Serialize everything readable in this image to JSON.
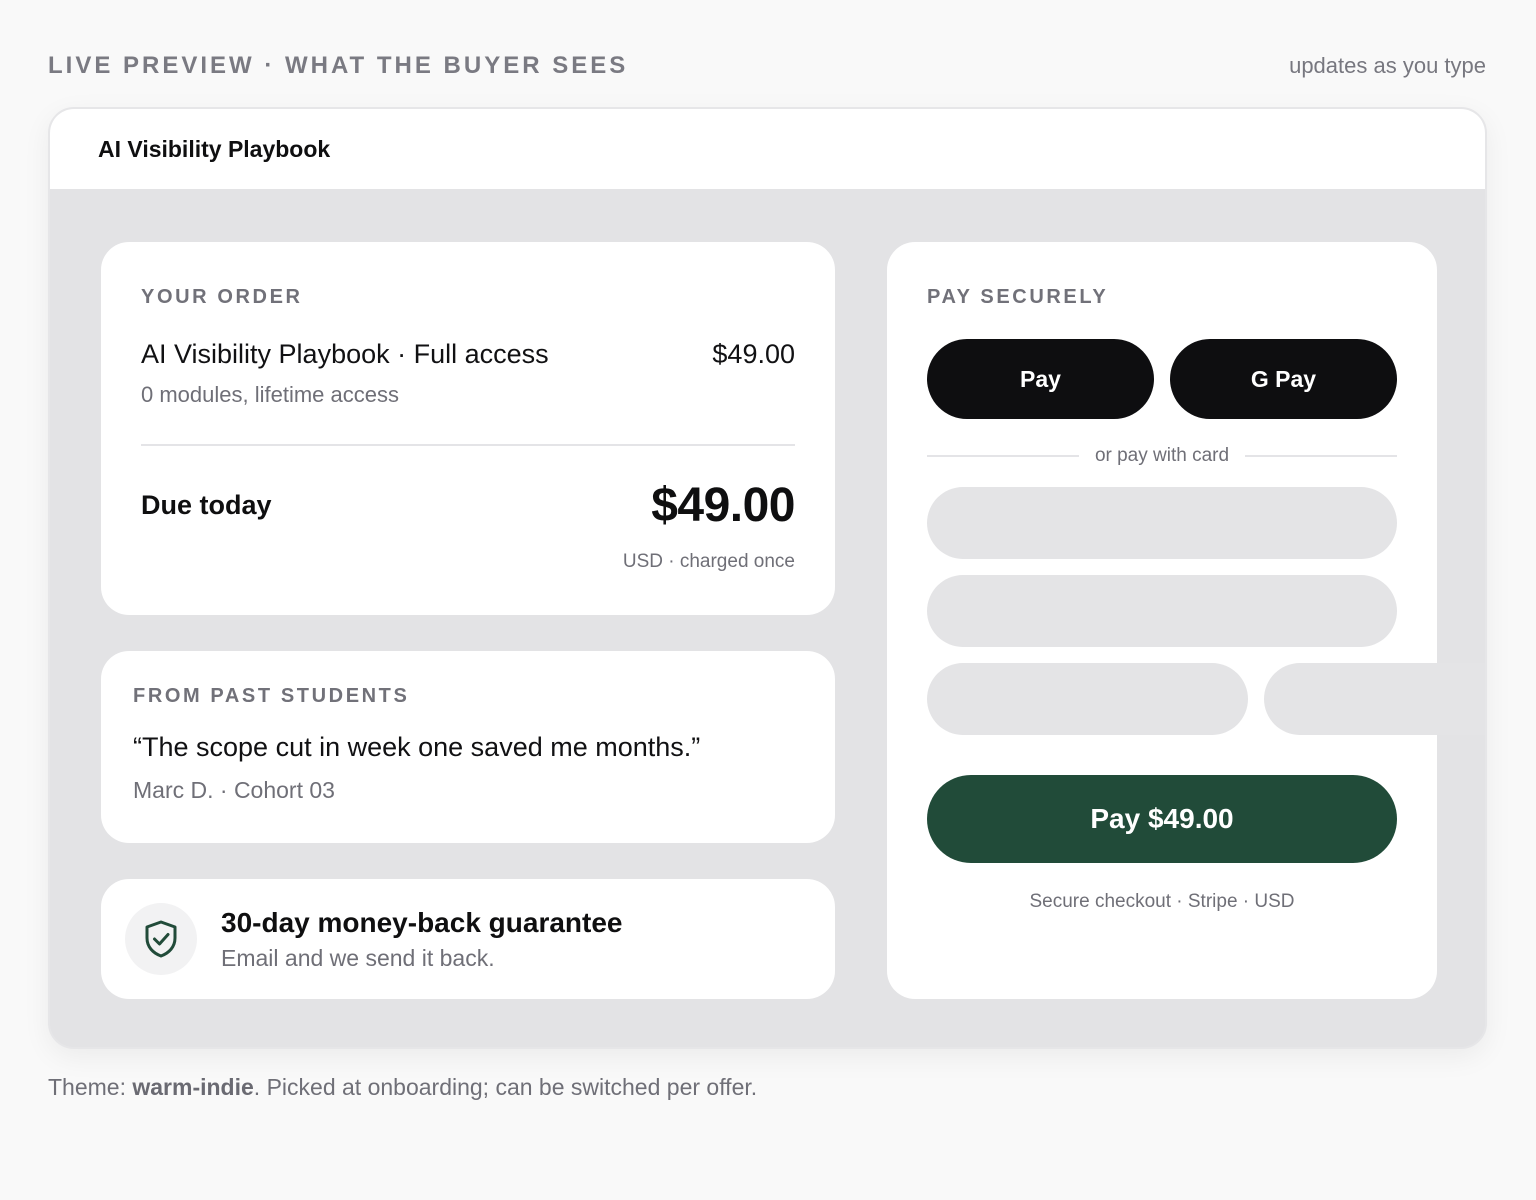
{
  "top": {
    "eyebrow": "LIVE PREVIEW · WHAT THE BUYER SEES",
    "hint": "updates as you type"
  },
  "preview": {
    "title": "AI Visibility Playbook"
  },
  "order": {
    "label": "YOUR ORDER",
    "item_name": "AI Visibility Playbook · Full access",
    "item_price": "$49.00",
    "item_sub": "0 modules, lifetime access",
    "due_label": "Due today",
    "due_amount": "$49.00",
    "due_note": "USD · charged once"
  },
  "testimonial": {
    "label": "FROM PAST STUDENTS",
    "quote": "“The scope cut in week one saved me months.”",
    "attribution": "Marc D. · Cohort 03"
  },
  "guarantee": {
    "icon": "shield-check-icon",
    "title": "30-day money-back guarantee",
    "sub": "Email and we send it back."
  },
  "pay": {
    "label": "PAY SECURELY",
    "apple_pay": "Pay",
    "google_pay": "G Pay",
    "divider_text": "or pay with card",
    "card_number": "",
    "card_name": "",
    "expiry": "",
    "cvc": "",
    "cta": "Pay $49.00",
    "secure_note": "Secure checkout · Stripe · USD"
  },
  "footer": {
    "prefix": "Theme: ",
    "theme": "warm-indie",
    "suffix": ". Picked at onboarding; can be switched per offer."
  },
  "colors": {
    "accent": "#214b39",
    "wallet_button": "#0e0e10",
    "canvas": "#e3e3e5"
  }
}
